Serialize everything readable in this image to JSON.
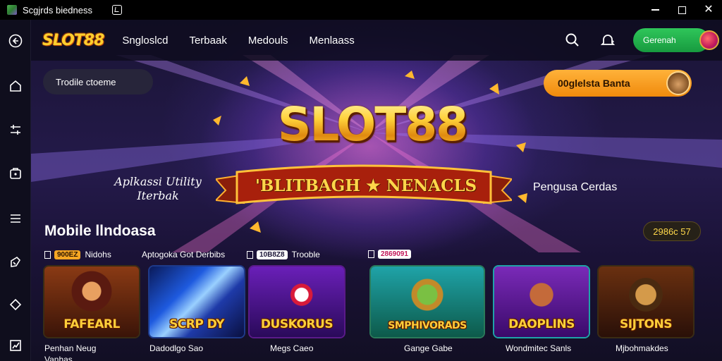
{
  "window": {
    "title": "Scgjrds biedness"
  },
  "nav": {
    "logo": "SLOT88",
    "links": [
      "Sngloslcd",
      "Terbaak",
      "Medouls",
      "Menlaass"
    ],
    "cta_label": "Gerenah"
  },
  "hero": {
    "search_text": "Trodile ctoeme",
    "promo_label": "00glelsta Banta",
    "logo_text": "SLOT88",
    "ribbon_text": "'BLITBAGH ★ NENACLS",
    "tagline_left": "Aplkassi Utility Iterbak",
    "tagline_right": "Pengusa Cerdas"
  },
  "section": {
    "title": "Mobile llndoasa",
    "badge": "2986c 57"
  },
  "categories": [
    {
      "chip": "900EZ",
      "label": "Nidohs",
      "chip_color": "#f5a623"
    },
    {
      "chip": "",
      "label": "Aptogoka Got Derbibs",
      "chip_color": ""
    },
    {
      "chip": "10B8Z8",
      "label": "Trooble",
      "chip_color": "#ffffff"
    },
    {
      "chip": "2869091",
      "label": "",
      "chip_color": "#ffffff"
    }
  ],
  "games": [
    {
      "title": "FAFEARL",
      "label": "Penhan Neug Vanhas"
    },
    {
      "title": "SCRP DY",
      "label": "Dadodlgo Sao"
    },
    {
      "title": "DUSKORUS",
      "label": "Megs Caeo"
    },
    {
      "title": "SMPHIVORADS",
      "label": "Gange Gabe"
    },
    {
      "title": "DAOPLINS",
      "label": "Wondmitec Sanls"
    },
    {
      "title": "SIJTONS",
      "label": "Mjbohmakdes"
    }
  ],
  "colors": {
    "accent_gold": "#ffd84a",
    "cta_green": "#1fae4a",
    "promo_orange": "#f59a1c",
    "background": "#1a1436"
  }
}
